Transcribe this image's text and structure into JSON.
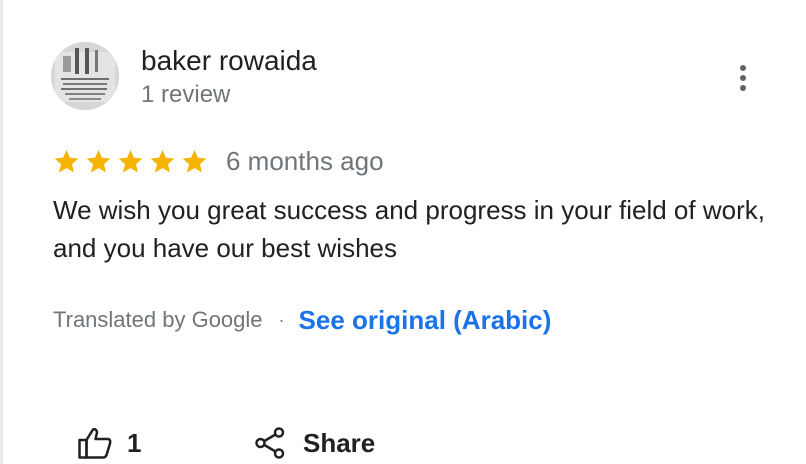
{
  "review": {
    "author_name": "baker rowaida",
    "review_count": "1 review",
    "rating": 5,
    "rating_max": 5,
    "time_ago": "6 months ago",
    "text": "We wish you great success and progress in your field of work, and you have our best wishes",
    "translated_by": "Translated by Google",
    "separator": "·",
    "see_original": "See original (Arabic)"
  },
  "actions": {
    "like_count": "1",
    "share_label": "Share"
  },
  "icons": {
    "more": "more-vert-icon",
    "like": "thumb-up-icon",
    "share": "share-icon",
    "star": "star-icon"
  },
  "colors": {
    "star": "#f4b400",
    "link": "#1a73e8",
    "secondary_text": "#70757a",
    "primary_text": "#202124"
  }
}
